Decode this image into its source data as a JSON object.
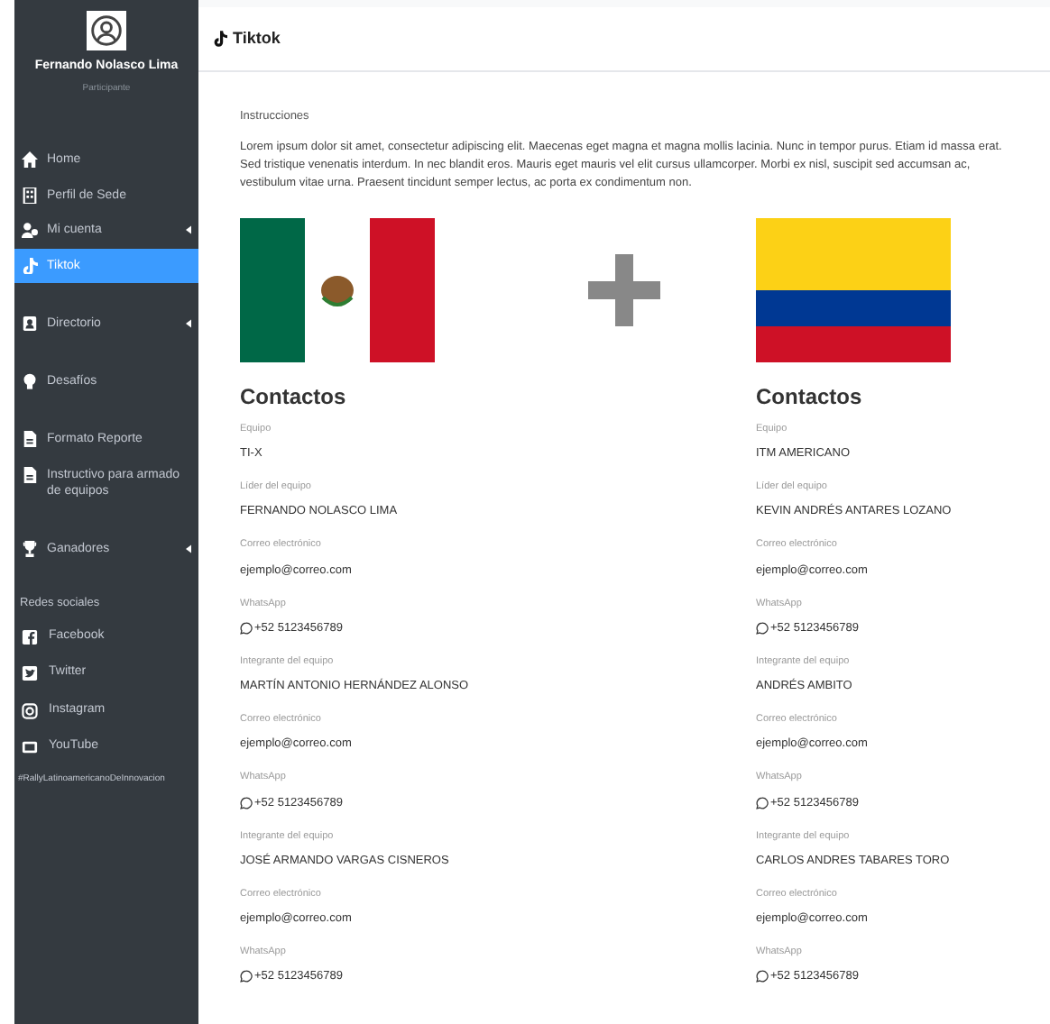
{
  "user": {
    "name": "Fernando Nolasco Lima",
    "role": "Participante"
  },
  "nav_groups": [
    [
      {
        "label": "Home",
        "selected": false,
        "submenu": false
      },
      {
        "label": "Perfil de Sede",
        "selected": false,
        "submenu": false
      },
      {
        "label": "Mi cuenta",
        "selected": false,
        "submenu": true
      },
      {
        "label": "Tiktok",
        "selected": true,
        "submenu": false
      }
    ],
    [
      {
        "label": "Directorio",
        "selected": false,
        "submenu": true
      }
    ],
    [
      {
        "label": "Desafíos",
        "selected": false,
        "submenu": false
      }
    ],
    [
      {
        "label": "Formato Reporte",
        "selected": false,
        "submenu": false
      },
      {
        "label": "Instructivo para armado de equipos",
        "selected": false,
        "submenu": false
      }
    ],
    [
      {
        "label": "Ganadores",
        "selected": false,
        "submenu": true
      }
    ]
  ],
  "social": {
    "heading": "Redes sociales",
    "items": [
      {
        "label": "Facebook"
      },
      {
        "label": "Twitter"
      },
      {
        "label": "Instagram"
      },
      {
        "label": "YouTube"
      }
    ],
    "hashtag": "#RallyLatinoamericanoDeInnovacion"
  },
  "page": {
    "title": "Tiktok",
    "instructions_label": "Instrucciones",
    "instructions": "Lorem ipsum dolor sit amet, consectetur adipiscing elit. Maecenas eget magna et magna mollis lacinia. Nunc in tempor purus. Etiam id massa erat. Sed tristique venenatis interdum. In nec blandit eros. Mauris eget mauris vel elit cursus ullamcorper. Morbi ex nisl, suscipit sed accumsan ac, vestibulum vitae urna. Praesent tincidunt semper lectus, ac porta ex condimentum non."
  },
  "teams": [
    {
      "heading": "Contactos",
      "fields": [
        {
          "label": "Equipo",
          "value": "TI-X",
          "kind": "text"
        },
        {
          "label": "Líder del equipo",
          "value": "FERNANDO NOLASCO LIMA",
          "kind": "text"
        },
        {
          "label": "Correo electrónico",
          "value": "ejemplo@correo.com",
          "kind": "text"
        },
        {
          "label": "WhatsApp",
          "value": "+52 5123456789",
          "kind": "whatsapp"
        },
        {
          "label": "Integrante del equipo",
          "value": "MARTÍN ANTONIO HERNÁNDEZ ALONSO",
          "kind": "text"
        },
        {
          "label": "Correo electrónico",
          "value": "ejemplo@correo.com",
          "kind": "text"
        },
        {
          "label": "WhatsApp",
          "value": "+52 5123456789",
          "kind": "whatsapp"
        },
        {
          "label": "Integrante del equipo",
          "value": "JOSÉ ARMANDO VARGAS CISNEROS",
          "kind": "text"
        },
        {
          "label": "Correo electrónico",
          "value": "ejemplo@correo.com",
          "kind": "text"
        },
        {
          "label": "WhatsApp",
          "value": "+52 5123456789",
          "kind": "whatsapp"
        }
      ]
    },
    {
      "heading": "Contactos",
      "fields": [
        {
          "label": "Equipo",
          "value": "ITM AMERICANO",
          "kind": "text"
        },
        {
          "label": "Líder del equipo",
          "value": "KEVIN ANDRÉS ANTARES LOZANO",
          "kind": "text"
        },
        {
          "label": "Correo electrónico",
          "value": "ejemplo@correo.com",
          "kind": "text"
        },
        {
          "label": "WhatsApp",
          "value": "+52 5123456789",
          "kind": "whatsapp"
        },
        {
          "label": "Integrante del equipo",
          "value": "ANDRÉS AMBITO",
          "kind": "text"
        },
        {
          "label": "Correo electrónico",
          "value": "ejemplo@correo.com",
          "kind": "text"
        },
        {
          "label": "WhatsApp",
          "value": "+52 5123456789",
          "kind": "whatsapp"
        },
        {
          "label": "Integrante del equipo",
          "value": "CARLOS ANDRES TABARES TORO",
          "kind": "text"
        },
        {
          "label": "Correo electrónico",
          "value": "ejemplo@correo.com",
          "kind": "text"
        },
        {
          "label": "WhatsApp",
          "value": "+52 5123456789",
          "kind": "whatsapp"
        }
      ]
    }
  ]
}
